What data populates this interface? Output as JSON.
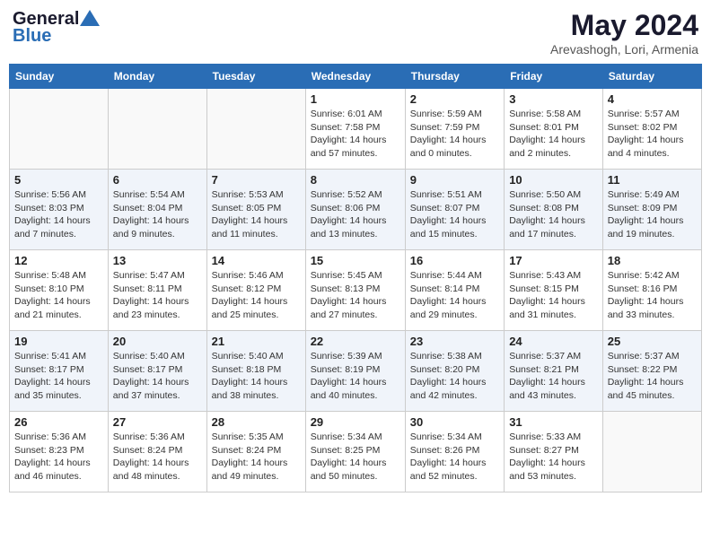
{
  "header": {
    "logo_line1": "General",
    "logo_line2": "Blue",
    "month": "May 2024",
    "location": "Arevashogh, Lori, Armenia"
  },
  "weekdays": [
    "Sunday",
    "Monday",
    "Tuesday",
    "Wednesday",
    "Thursday",
    "Friday",
    "Saturday"
  ],
  "weeks": [
    [
      {
        "day": "",
        "info": ""
      },
      {
        "day": "",
        "info": ""
      },
      {
        "day": "",
        "info": ""
      },
      {
        "day": "1",
        "info": "Sunrise: 6:01 AM\nSunset: 7:58 PM\nDaylight: 14 hours\nand 57 minutes."
      },
      {
        "day": "2",
        "info": "Sunrise: 5:59 AM\nSunset: 7:59 PM\nDaylight: 14 hours\nand 0 minutes."
      },
      {
        "day": "3",
        "info": "Sunrise: 5:58 AM\nSunset: 8:01 PM\nDaylight: 14 hours\nand 2 minutes."
      },
      {
        "day": "4",
        "info": "Sunrise: 5:57 AM\nSunset: 8:02 PM\nDaylight: 14 hours\nand 4 minutes."
      }
    ],
    [
      {
        "day": "5",
        "info": "Sunrise: 5:56 AM\nSunset: 8:03 PM\nDaylight: 14 hours\nand 7 minutes."
      },
      {
        "day": "6",
        "info": "Sunrise: 5:54 AM\nSunset: 8:04 PM\nDaylight: 14 hours\nand 9 minutes."
      },
      {
        "day": "7",
        "info": "Sunrise: 5:53 AM\nSunset: 8:05 PM\nDaylight: 14 hours\nand 11 minutes."
      },
      {
        "day": "8",
        "info": "Sunrise: 5:52 AM\nSunset: 8:06 PM\nDaylight: 14 hours\nand 13 minutes."
      },
      {
        "day": "9",
        "info": "Sunrise: 5:51 AM\nSunset: 8:07 PM\nDaylight: 14 hours\nand 15 minutes."
      },
      {
        "day": "10",
        "info": "Sunrise: 5:50 AM\nSunset: 8:08 PM\nDaylight: 14 hours\nand 17 minutes."
      },
      {
        "day": "11",
        "info": "Sunrise: 5:49 AM\nSunset: 8:09 PM\nDaylight: 14 hours\nand 19 minutes."
      }
    ],
    [
      {
        "day": "12",
        "info": "Sunrise: 5:48 AM\nSunset: 8:10 PM\nDaylight: 14 hours\nand 21 minutes."
      },
      {
        "day": "13",
        "info": "Sunrise: 5:47 AM\nSunset: 8:11 PM\nDaylight: 14 hours\nand 23 minutes."
      },
      {
        "day": "14",
        "info": "Sunrise: 5:46 AM\nSunset: 8:12 PM\nDaylight: 14 hours\nand 25 minutes."
      },
      {
        "day": "15",
        "info": "Sunrise: 5:45 AM\nSunset: 8:13 PM\nDaylight: 14 hours\nand 27 minutes."
      },
      {
        "day": "16",
        "info": "Sunrise: 5:44 AM\nSunset: 8:14 PM\nDaylight: 14 hours\nand 29 minutes."
      },
      {
        "day": "17",
        "info": "Sunrise: 5:43 AM\nSunset: 8:15 PM\nDaylight: 14 hours\nand 31 minutes."
      },
      {
        "day": "18",
        "info": "Sunrise: 5:42 AM\nSunset: 8:16 PM\nDaylight: 14 hours\nand 33 minutes."
      }
    ],
    [
      {
        "day": "19",
        "info": "Sunrise: 5:41 AM\nSunset: 8:17 PM\nDaylight: 14 hours\nand 35 minutes."
      },
      {
        "day": "20",
        "info": "Sunrise: 5:40 AM\nSunset: 8:17 PM\nDaylight: 14 hours\nand 37 minutes."
      },
      {
        "day": "21",
        "info": "Sunrise: 5:40 AM\nSunset: 8:18 PM\nDaylight: 14 hours\nand 38 minutes."
      },
      {
        "day": "22",
        "info": "Sunrise: 5:39 AM\nSunset: 8:19 PM\nDaylight: 14 hours\nand 40 minutes."
      },
      {
        "day": "23",
        "info": "Sunrise: 5:38 AM\nSunset: 8:20 PM\nDaylight: 14 hours\nand 42 minutes."
      },
      {
        "day": "24",
        "info": "Sunrise: 5:37 AM\nSunset: 8:21 PM\nDaylight: 14 hours\nand 43 minutes."
      },
      {
        "day": "25",
        "info": "Sunrise: 5:37 AM\nSunset: 8:22 PM\nDaylight: 14 hours\nand 45 minutes."
      }
    ],
    [
      {
        "day": "26",
        "info": "Sunrise: 5:36 AM\nSunset: 8:23 PM\nDaylight: 14 hours\nand 46 minutes."
      },
      {
        "day": "27",
        "info": "Sunrise: 5:36 AM\nSunset: 8:24 PM\nDaylight: 14 hours\nand 48 minutes."
      },
      {
        "day": "28",
        "info": "Sunrise: 5:35 AM\nSunset: 8:24 PM\nDaylight: 14 hours\nand 49 minutes."
      },
      {
        "day": "29",
        "info": "Sunrise: 5:34 AM\nSunset: 8:25 PM\nDaylight: 14 hours\nand 50 minutes."
      },
      {
        "day": "30",
        "info": "Sunrise: 5:34 AM\nSunset: 8:26 PM\nDaylight: 14 hours\nand 52 minutes."
      },
      {
        "day": "31",
        "info": "Sunrise: 5:33 AM\nSunset: 8:27 PM\nDaylight: 14 hours\nand 53 minutes."
      },
      {
        "day": "",
        "info": ""
      }
    ]
  ]
}
